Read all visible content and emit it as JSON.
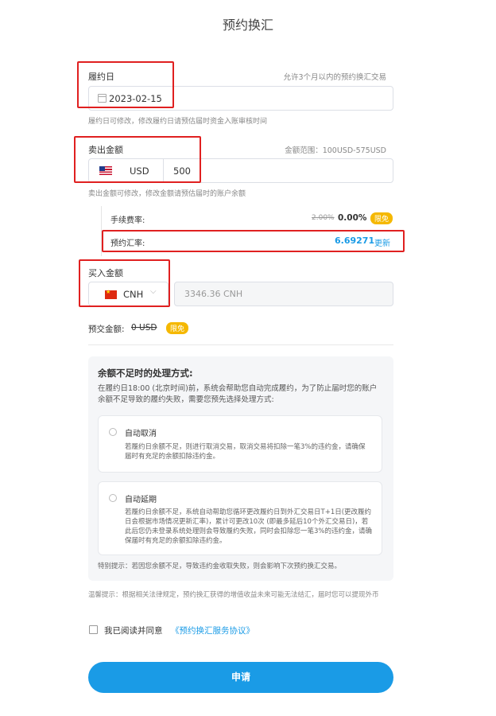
{
  "page": {
    "title": "预约换汇"
  },
  "settlement": {
    "label": "履约日",
    "hint": "允许3个月以内的预约换汇交易",
    "date_value": "2023-02-15",
    "helper": "履约日可修改，修改履约日请预估届时资金入账审核时间"
  },
  "sell": {
    "label": "卖出金额",
    "hint": "金额范围：100USD-575USD",
    "currency": "USD",
    "amount": "500",
    "helper": "卖出金额可修改，修改金额请预估届时的账户余额"
  },
  "fee": {
    "label": "手续费率:",
    "original_rate": "2.00%",
    "rate": "0.00%",
    "badge": "限免"
  },
  "rate": {
    "label": "预约汇率:",
    "value": "6.69271",
    "refresh_label": "更新"
  },
  "buy": {
    "label": "买入金额",
    "currency": "CNH",
    "amount": "3346.36 CNH"
  },
  "deposit": {
    "label": "预交金额:",
    "value": "0 USD",
    "badge": "限免"
  },
  "insufficient": {
    "title": "余额不足时的处理方式:",
    "desc": "在履约日18:00 (北京时间)前，系统会帮助您自动完成履约，为了防止届时您的账户余额不足导致的履约失败，需要您预先选择处理方式:",
    "options": [
      {
        "title": "自动取消",
        "desc": "若履约日余额不足，则进行取消交易，取消交易将扣除一笔3%的违约金，请确保届时有充足的余额扣除违约金。"
      },
      {
        "title": "自动延期",
        "desc": "若履约日余额不足，系统自动帮助您循环更改履约日到外汇交易日T+1日(更改履约日会根据市场情况更新汇率)，累计可更改10次 (即最多延后10个外汇交易日)，若此后您仍未登录系统处理则会导致履约失败，同时会扣除您一笔3%的违约金，请确保届时有充足的余额扣除违约金。"
      }
    ],
    "note": "特别提示：若因您余额不足，导致违约金收取失败，则会影响下次预约换汇交易。"
  },
  "warm_tip": "温馨提示：根据相关法律规定，预约换汇获得的增值收益未来可能无法结汇，届时您可以提现外币",
  "agreement": {
    "prefix": "我已阅读并同意",
    "link": "《预约换汇服务协议》"
  },
  "submit_label": "申请",
  "colors": {
    "accent": "#1a9be6",
    "badge": "#f5b800",
    "highlight_box": "#e02020"
  }
}
